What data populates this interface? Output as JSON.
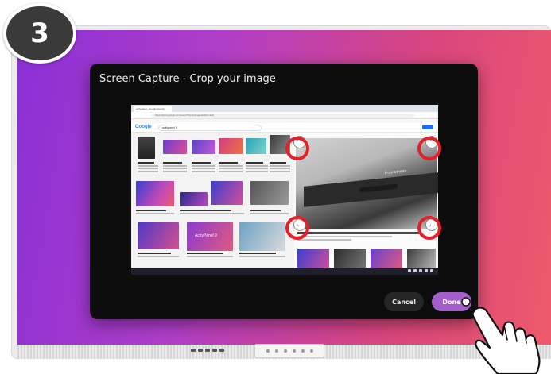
{
  "step": {
    "number": "3"
  },
  "dialog": {
    "title": "Screen Capture - Crop your image",
    "cancel_label": "Cancel",
    "done_label": "Done"
  },
  "capture": {
    "tab_label": "activpanel - Google Search",
    "address": "https://www.google.com/search?q=activpanel&tbm=isch",
    "search_logo": "Google",
    "search_query": "activpanel 9",
    "preview_brand": "Promethean",
    "product_label": "ActivPanel 9"
  },
  "colors": {
    "accent": "#a35fc9",
    "highlight_ring": "#e4212a",
    "dialog_bg": "#0d0d0d"
  },
  "icons": [
    "hand-pointer-icon",
    "crop-handle-icon"
  ]
}
